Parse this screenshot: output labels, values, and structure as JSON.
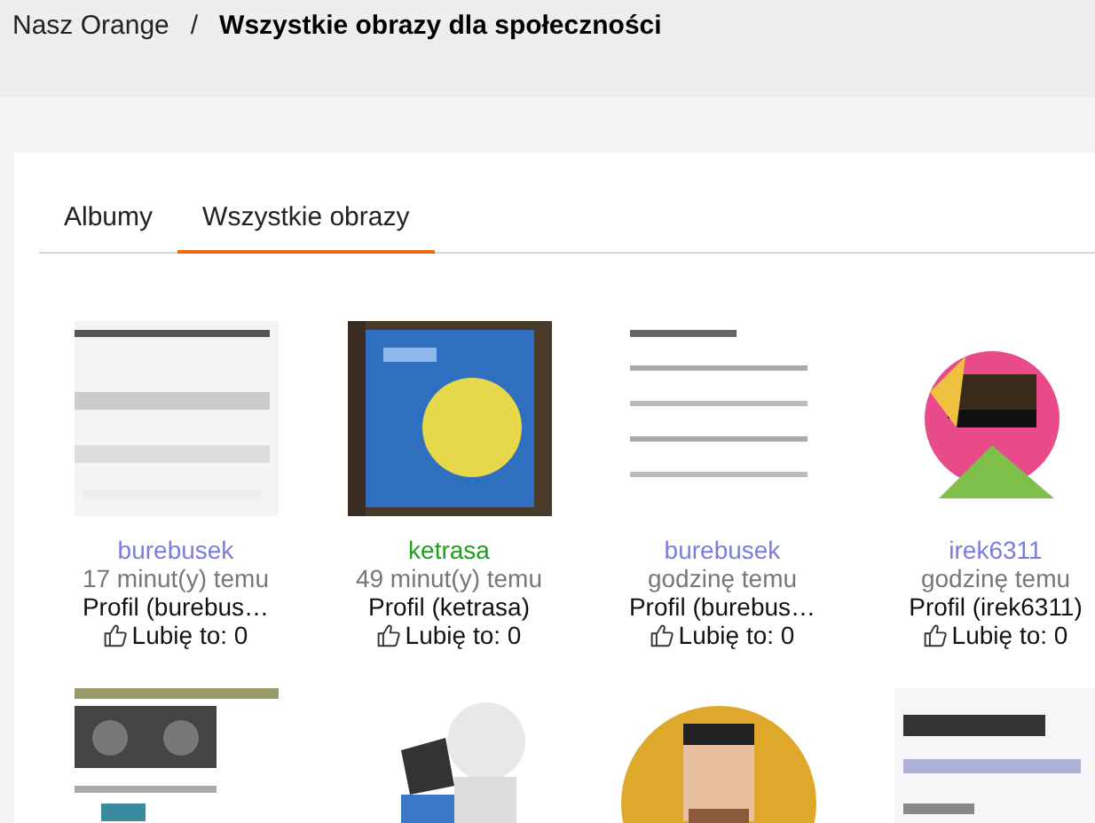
{
  "breadcrumb": {
    "parent": "Nasz Orange",
    "separator": "/",
    "current": "Wszystkie obrazy dla społeczności"
  },
  "tabs": [
    {
      "label": "Albumy",
      "selected": false
    },
    {
      "label": "Wszystkie obrazy",
      "selected": true
    }
  ],
  "images": [
    {
      "kind": "picture",
      "author": "burebusek",
      "color": "#7b7be0",
      "time": "17 minut(y) temu",
      "profile": "Profil (burebus…",
      "likes": "Lubię to: 0"
    },
    {
      "kind": "picture",
      "author": "ketrasa",
      "color": "#1f9e1f",
      "time": "49 minut(y) temu",
      "profile": "Profil (ketrasa)",
      "likes": "Lubię to: 0"
    },
    {
      "kind": "picture",
      "author": "burebusek",
      "color": "#7b7be0",
      "time": "godzinę temu",
      "profile": "Profil (burebus…",
      "likes": "Lubię to: 0"
    },
    {
      "kind": "picture",
      "author": "irek6311",
      "color": "#7b7be0",
      "time": "godzinę temu",
      "profile": "Profil (irek6311)",
      "likes": "Lubię to: 0"
    },
    {
      "kind": "picture"
    },
    {
      "kind": "picture"
    },
    {
      "kind": "picture"
    },
    {
      "kind": "picture"
    }
  ]
}
